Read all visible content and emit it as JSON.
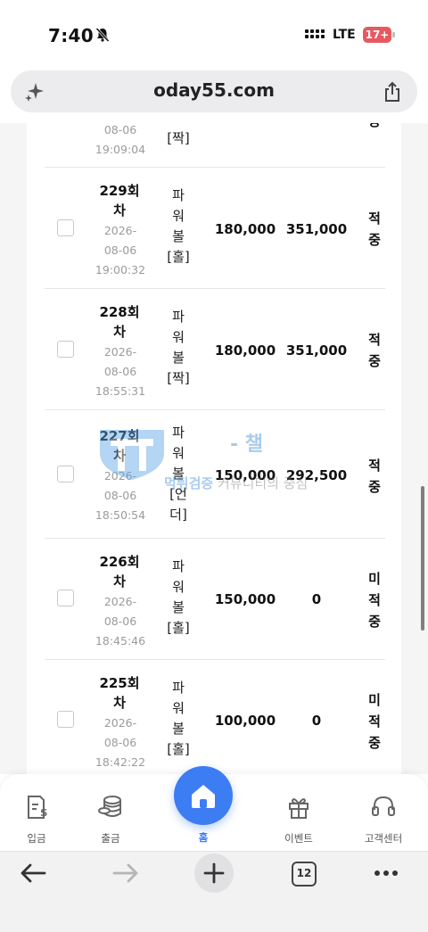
{
  "status_bar": {
    "time": "7:40",
    "network": "LTE",
    "battery": "17+"
  },
  "browser": {
    "url": "oday55.com",
    "tab_count": "12"
  },
  "rows": [
    {
      "round": "",
      "date": [
        "08-06",
        "19:09:04"
      ],
      "pick": [
        "[짝]"
      ],
      "bet": "",
      "win": "",
      "result": [
        "중"
      ]
    },
    {
      "round": [
        "229회",
        "차"
      ],
      "date": [
        "2026-",
        "08-06",
        "19:00:32"
      ],
      "pick": [
        "파",
        "워",
        "볼",
        "[홀]"
      ],
      "bet": "180,000",
      "win": "351,000",
      "result": [
        "적",
        "중"
      ]
    },
    {
      "round": [
        "228회",
        "차"
      ],
      "date": [
        "2026-",
        "08-06",
        "18:55:31"
      ],
      "pick": [
        "파",
        "워",
        "볼",
        "[짝]"
      ],
      "bet": "180,000",
      "win": "351,000",
      "result": [
        "적",
        "중"
      ]
    },
    {
      "round": [
        "227회",
        "차"
      ],
      "date": [
        "2026-",
        "08-06",
        "18:50:54"
      ],
      "pick": [
        "파",
        "워",
        "볼",
        "[언",
        "더]"
      ],
      "bet": "150,000",
      "win": "292,500",
      "result": [
        "적",
        "중"
      ]
    },
    {
      "round": [
        "226회",
        "차"
      ],
      "date": [
        "2026-",
        "08-06",
        "18:45:46"
      ],
      "pick": [
        "파",
        "워",
        "볼",
        "[홀]"
      ],
      "bet": "150,000",
      "win": "0",
      "result": [
        "미",
        "적",
        "중"
      ]
    },
    {
      "round": [
        "225회",
        "차"
      ],
      "date": [
        "2026-",
        "08-06",
        "18:42:22"
      ],
      "pick": [
        "파",
        "워",
        "볼",
        "[홀]"
      ],
      "bet": "100,000",
      "win": "0",
      "result": [
        "미",
        "적",
        "중"
      ]
    }
  ],
  "watermark": {
    "title": "- 챌",
    "sub_bold": "먹튀검증",
    "sub_rest": " 커뮤니티의 중심"
  },
  "tabbar": {
    "deposit": "입금",
    "withdraw": "출금",
    "home": "홈",
    "event": "이벤트",
    "support": "고객센터"
  },
  "colors": {
    "accent": "#3d7df3",
    "battery": "#e8585f"
  }
}
